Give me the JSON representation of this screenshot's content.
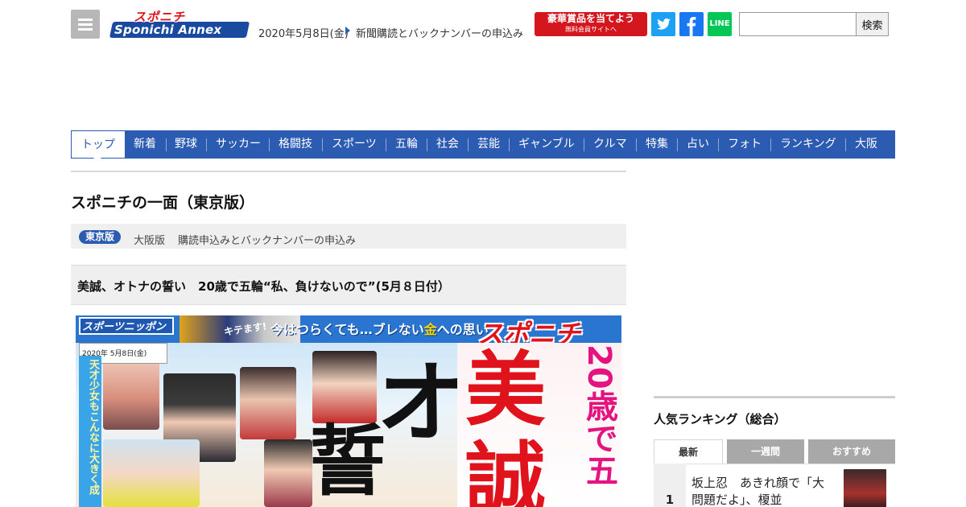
{
  "header": {
    "logo_top": "スポニチ",
    "logo_bottom": "Sponichi Annex",
    "date": "2020年5月8日(金)",
    "subscription_link": "新聞購読とバックナンバーの申込み",
    "prize_main": "豪華賞品を当てよう",
    "prize_sub": "無料会員サイトへ",
    "line_label": "LINE",
    "search_placeholder": "",
    "search_button": "検索"
  },
  "nav": {
    "items": [
      {
        "label": "トップ",
        "active": true
      },
      {
        "label": "新着"
      },
      {
        "label": "野球"
      },
      {
        "label": "サッカー"
      },
      {
        "label": "格闘技"
      },
      {
        "label": "スポーツ"
      },
      {
        "label": "五輪"
      },
      {
        "label": "社会"
      },
      {
        "label": "芸能"
      },
      {
        "label": "ギャンブル"
      },
      {
        "label": "クルマ"
      },
      {
        "label": "特集"
      },
      {
        "label": "占い"
      },
      {
        "label": "フォト"
      },
      {
        "label": "ランキング"
      },
      {
        "label": "大阪"
      }
    ]
  },
  "main": {
    "page_title": "スポニチの一面（東京版）",
    "edition_tokyo": "東京版",
    "edition_osaka": "大阪版",
    "edition_order": "購読申込みとバックナンバーの申込み",
    "headline": "美誠、オトナの誓い　20歳で五輪“私、負けないので”(5月８日付）"
  },
  "front_page": {
    "paper_name": "スポーツニッポン",
    "kiteru": "キテます!",
    "tagline_pre": "今はつらくても…ブレない",
    "tagline_gold": "金",
    "tagline_post": "への思い",
    "brand": "スポニチ",
    "date_line": "2020年 5月8日(金)",
    "kids_caption": "天才少女もこんなに大きく成",
    "oto": "オト",
    "chika": "誓",
    "mi": "美",
    "sei": "誠",
    "age": "20歳で五"
  },
  "sidebar": {
    "ranking_title": "人気ランキング（総合）",
    "tabs": [
      "最新",
      "一週間",
      "おすすめ"
    ],
    "items": [
      {
        "rank": "1",
        "text": "坂上忍　あきれ顔で「大問題だよ」、榎並"
      }
    ]
  },
  "colors": {
    "nav_blue": "#2c5bb2",
    "brand_red": "#e0121b",
    "twitter": "#1da1f2",
    "facebook": "#1877f2",
    "line": "#06c755"
  }
}
